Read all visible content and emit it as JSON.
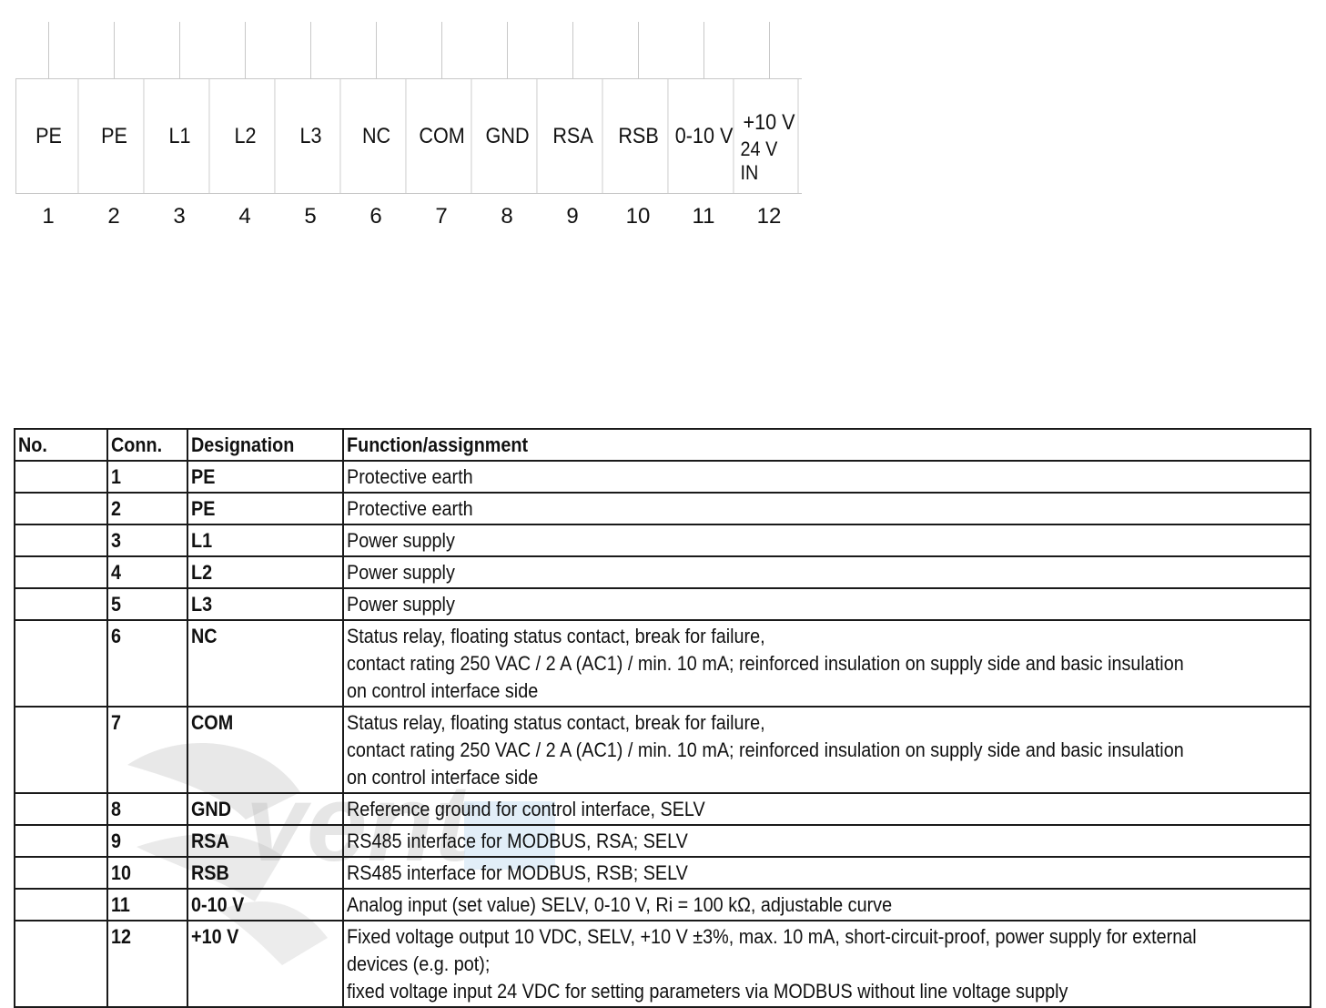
{
  "diagram": {
    "terminals": [
      {
        "number": "1",
        "label": "PE",
        "label2": ""
      },
      {
        "number": "2",
        "label": "PE",
        "label2": ""
      },
      {
        "number": "3",
        "label": "L1",
        "label2": ""
      },
      {
        "number": "4",
        "label": "L2",
        "label2": ""
      },
      {
        "number": "5",
        "label": "L3",
        "label2": ""
      },
      {
        "number": "6",
        "label": "NC",
        "label2": ""
      },
      {
        "number": "7",
        "label": "COM",
        "label2": ""
      },
      {
        "number": "8",
        "label": "GND",
        "label2": ""
      },
      {
        "number": "9",
        "label": "RSA",
        "label2": ""
      },
      {
        "number": "10",
        "label": "RSB",
        "label2": ""
      },
      {
        "number": "11",
        "label": "0-10 V",
        "label2": ""
      },
      {
        "number": "12",
        "label": "+10 V",
        "label2": "24 V IN"
      }
    ]
  },
  "table": {
    "headers": [
      "No.",
      "Conn.",
      "Designation",
      "Function/assignment"
    ],
    "rows": [
      {
        "no": "",
        "conn": "1",
        "designation": "PE",
        "function": [
          "Protective earth"
        ]
      },
      {
        "no": "",
        "conn": "2",
        "designation": "PE",
        "function": [
          "Protective earth"
        ]
      },
      {
        "no": "",
        "conn": "3",
        "designation": "L1",
        "function": [
          "Power supply"
        ]
      },
      {
        "no": "",
        "conn": "4",
        "designation": "L2",
        "function": [
          "Power supply"
        ]
      },
      {
        "no": "",
        "conn": "5",
        "designation": "L3",
        "function": [
          "Power supply"
        ]
      },
      {
        "no": "",
        "conn": "6",
        "designation": "NC",
        "function": [
          "Status relay, floating status contact, break for failure,",
          "contact rating 250 VAC / 2 A (AC1) / min. 10 mA; reinforced insulation on supply side and basic insulation",
          "on control interface side"
        ]
      },
      {
        "no": "",
        "conn": "7",
        "designation": "COM",
        "function": [
          "Status relay, floating status contact, break for failure,",
          "contact rating 250 VAC / 2 A (AC1) / min. 10 mA; reinforced insulation on supply side and basic insulation",
          "on control interface side"
        ]
      },
      {
        "no": "",
        "conn": "8",
        "designation": "GND",
        "function": [
          "Reference ground for control interface, SELV"
        ]
      },
      {
        "no": "",
        "conn": "9",
        "designation": "RSA",
        "function": [
          "RS485 interface for MODBUS, RSA; SELV"
        ]
      },
      {
        "no": "",
        "conn": "10",
        "designation": "RSB",
        "function": [
          "RS485 interface for MODBUS, RSB; SELV"
        ]
      },
      {
        "no": "",
        "conn": "11",
        "designation": "0-10 V",
        "function": [
          "Analog input (set value) SELV, 0-10 V, Ri = 100 kΩ, adjustable curve"
        ]
      },
      {
        "no": "",
        "conn": "12",
        "designation": "+10 V",
        "function": [
          "Fixed voltage output 10 VDC, SELV, +10 V ±3%, max. 10 mA, short-circuit-proof, power supply for external",
          "devices (e.g. pot);",
          "fixed voltage input 24 VDC for setting parameters via MODBUS without line voltage supply"
        ]
      }
    ]
  },
  "watermark": {
    "text": "vent",
    "accent_color": "#cfe3f4"
  }
}
